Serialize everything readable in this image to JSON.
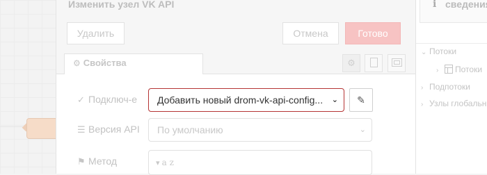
{
  "tray": {
    "title": "Изменить узел VK API",
    "delete_label": "Удалить",
    "cancel_label": "Отмена",
    "done_label": "Готово"
  },
  "tabs": {
    "properties_label": "Свойства"
  },
  "form": {
    "connection": {
      "label": "Подключ-е",
      "selected_value": "Добавить новый drom-vk-api-config..."
    },
    "api_version": {
      "label": "Версия API",
      "selected_value": "По умолчанию"
    },
    "method": {
      "label": "Метод",
      "type_glyph": "a z"
    }
  },
  "sidebar": {
    "title": "сведения",
    "tree": {
      "flows": "Потоки",
      "flow_item": "Потоки",
      "subflows": "Подпотоки",
      "global_nodes": "Узлы глобальные"
    }
  },
  "colors": {
    "done_button": "#f7c3c3",
    "focused_select_border": "#b53333"
  },
  "icons": {
    "properties_tab": "gear-icon",
    "connection_label": "plug-icon",
    "version_label": "list-icon",
    "method_label": "tag-icon",
    "edit_config": "pencil-icon",
    "sidebar_info": "info-icon"
  }
}
